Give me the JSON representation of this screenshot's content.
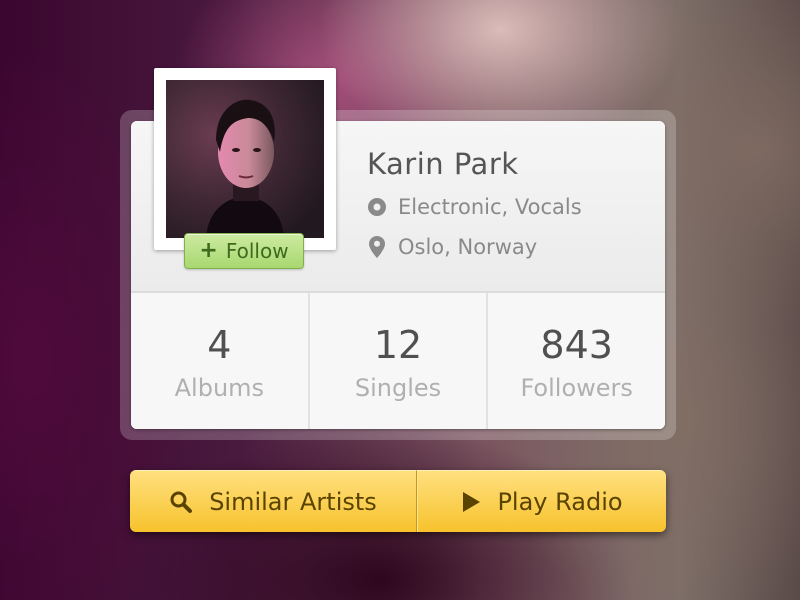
{
  "artist": {
    "name": "Karin Park",
    "genre": "Electronic, Vocals",
    "location": "Oslo, Norway",
    "photo_icon": "artist-portrait"
  },
  "follow": {
    "label": "Follow",
    "icon": "plus-icon",
    "color": "#a8d870"
  },
  "stats": [
    {
      "value": "4",
      "label": "Albums"
    },
    {
      "value": "12",
      "label": "Singles"
    },
    {
      "value": "843",
      "label": "Followers"
    }
  ],
  "icons": {
    "genre": "disc-icon",
    "location": "location-pin-icon"
  },
  "actions": {
    "similar_label": "Similar Artists",
    "similar_icon": "search-icon",
    "radio_label": "Play Radio",
    "radio_icon": "play-icon",
    "color": "#f7c22c"
  }
}
